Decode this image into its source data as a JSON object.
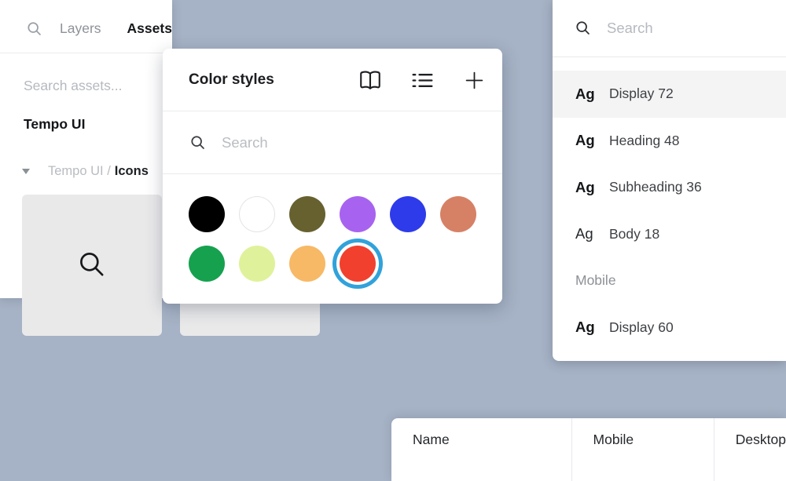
{
  "canvas": {
    "background_color": "#a6b2c5"
  },
  "left_panel": {
    "tabs": [
      {
        "label": "Layers"
      },
      {
        "label": "Assets"
      }
    ],
    "search_placeholder": "Search assets...",
    "library_name": "Tempo UI",
    "group": {
      "prefix": "Tempo UI /",
      "name": "Icons"
    },
    "asset_tiles": [
      {
        "icon": "search-icon"
      },
      {
        "icon": "filter-icon"
      }
    ]
  },
  "color_styles_panel": {
    "title": "Color styles",
    "toolbar_icons": [
      "book-icon",
      "list-view-icon",
      "add-icon"
    ],
    "search_placeholder": "Search",
    "selection_ring_color": "#31a2da",
    "swatches": [
      {
        "color": "#000000",
        "selected": false
      },
      {
        "color": "#ffffff",
        "selected": false
      },
      {
        "color": "#676130",
        "selected": false
      },
      {
        "color": "#a763ef",
        "selected": false
      },
      {
        "color": "#2e3bea",
        "selected": false
      },
      {
        "color": "#d68165",
        "selected": false
      },
      {
        "color": "#16a14f",
        "selected": false
      },
      {
        "color": "#dff29b",
        "selected": false
      },
      {
        "color": "#f7b966",
        "selected": false
      },
      {
        "color": "#f1402e",
        "selected": true
      }
    ]
  },
  "text_styles_panel": {
    "search_placeholder": "Search",
    "rows": [
      {
        "type": "style",
        "preview": "Ag",
        "label": "Display 72",
        "highlighted": true
      },
      {
        "type": "style",
        "preview": "Ag",
        "label": "Heading 48",
        "highlighted": false
      },
      {
        "type": "style",
        "preview": "Ag",
        "label": "Subheading 36",
        "highlighted": false
      },
      {
        "type": "style",
        "preview": "Ag",
        "label": "Body 18",
        "highlighted": false
      },
      {
        "type": "section",
        "label": "Mobile"
      },
      {
        "type": "style",
        "preview": "Ag",
        "label": "Display 60",
        "highlighted": false
      }
    ]
  },
  "table_panel": {
    "columns": [
      {
        "label": "Name"
      },
      {
        "label": "Mobile"
      },
      {
        "label": "Desktop"
      }
    ]
  }
}
